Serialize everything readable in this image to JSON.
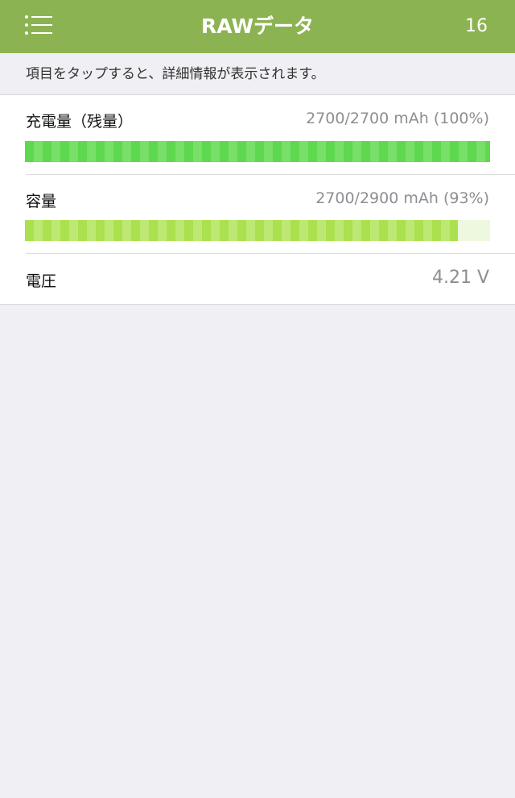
{
  "nav": {
    "title": "RAWデータ",
    "count": "16",
    "menu_icon": "list-menu-icon"
  },
  "hint": {
    "text": "項目をタップすると、詳細情報が表示されます。"
  },
  "rows": [
    {
      "label": "充電量（残量）",
      "value": "2700/2700 mAh (100%)",
      "progress": 1.0,
      "color": "#5ed84e"
    },
    {
      "label": "容量",
      "value": "2700/2900 mAh (93%)",
      "progress": 0.93,
      "color": "#abe04e"
    },
    {
      "label": "電圧",
      "value": "4.21 V"
    }
  ],
  "colors": {
    "navbar": "#8cb352",
    "background": "#efeff4"
  }
}
